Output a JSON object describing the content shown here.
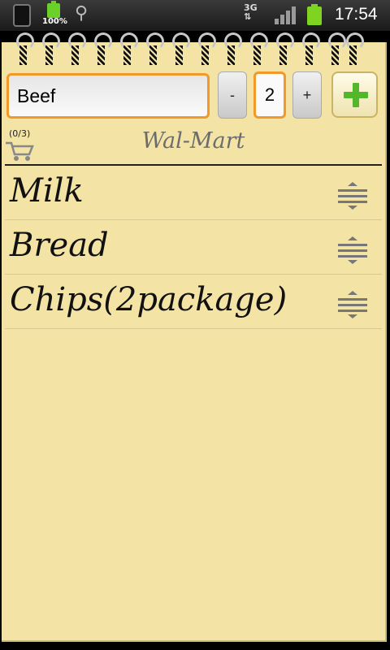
{
  "status_bar": {
    "battery_percent": "100%",
    "network_type": "3G",
    "time": "17:54"
  },
  "entry": {
    "item_text": "Beef",
    "decrement_label": "-",
    "quantity": "2",
    "increment_label": "+"
  },
  "list_header": {
    "count": "(0/3)",
    "store_name": "Wal-Mart"
  },
  "items": [
    {
      "label": "Milk"
    },
    {
      "label": "Bread"
    },
    {
      "label": "Chips(2package)"
    }
  ],
  "colors": {
    "paper": "#f3e3a5",
    "accent_orange": "#f1992a",
    "add_green": "#52b82a"
  }
}
